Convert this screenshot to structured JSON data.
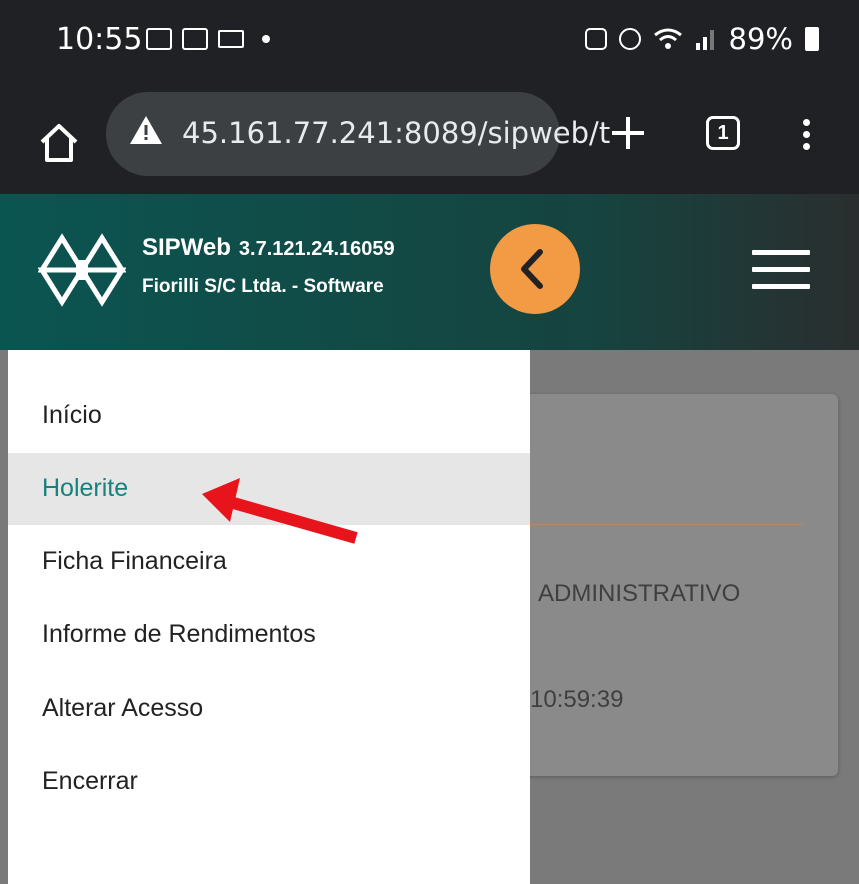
{
  "status_bar": {
    "time": "10:55",
    "battery": "89%"
  },
  "browser": {
    "url": "45.161.77.241:8089/sipweb/t",
    "tab_count": "1"
  },
  "header": {
    "app_name": "SIPWeb",
    "version": "3.7.121.24.16059",
    "company": "Fiorilli S/C Ltda. - Software"
  },
  "menu": {
    "items": [
      {
        "label": "Início"
      },
      {
        "label": "Holerite",
        "active": true
      },
      {
        "label": "Ficha Financeira"
      },
      {
        "label": "Informe de Rendimentos"
      },
      {
        "label": "Alterar Acesso"
      },
      {
        "label": "Encerrar"
      }
    ]
  },
  "card": {
    "label": "ADMINISTRATIVO",
    "time": "10:59:39"
  },
  "colors": {
    "header_teal": "#0b5551",
    "accent_orange": "#f39a44",
    "active_text": "#17827c",
    "arrow_red": "#e8141b"
  },
  "icons": {
    "status": [
      "image-icon",
      "voicemail-icon",
      "laptop-icon",
      "sync-icon",
      "alarm-icon",
      "wifi-icon",
      "signal-icon",
      "battery-icon"
    ],
    "browser": [
      "home-icon",
      "warning-icon",
      "plus-icon",
      "tabs-icon",
      "more-vert-icon"
    ]
  }
}
